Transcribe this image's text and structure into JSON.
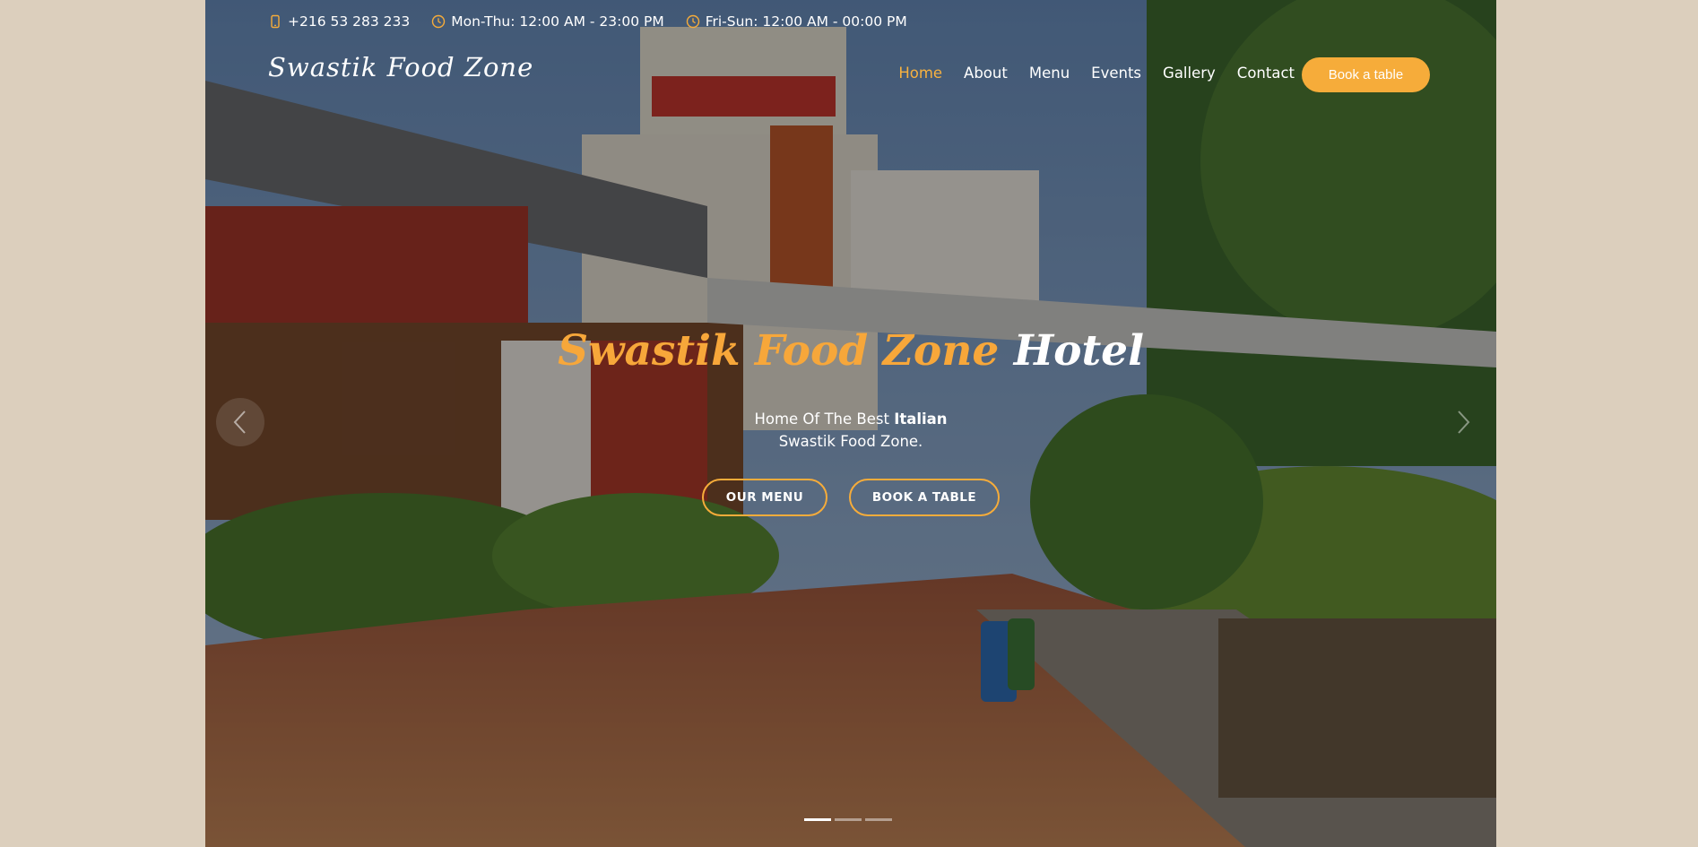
{
  "topbar": {
    "phone": "+216 53 283 233",
    "hours_weekday": "Mon-Thu: 12:00 AM - 23:00 PM",
    "hours_weekend": "Fri-Sun: 12:00 AM - 00:00 PM"
  },
  "brand": {
    "logo": "Swastik Food Zone"
  },
  "nav": {
    "items": [
      "Home",
      "About",
      "Menu",
      "Events",
      "Gallery",
      "Contact"
    ],
    "active": "Home",
    "book_label": "Book a table"
  },
  "hero": {
    "title_accent": "Swastik Food Zone",
    "title_plain": "Hotel",
    "subtitle_prefix": "Home Of The Best",
    "subtitle_bold": "Italian",
    "subtitle_line2": "Swastik Food Zone.",
    "btn_menu": "OUR MENU",
    "btn_table": "BOOK A TABLE",
    "slide_count": 3,
    "active_slide": 1
  },
  "colors": {
    "accent": "#f6ac3a",
    "page_bg": "#dccfbd"
  },
  "icons": [
    "phone-icon",
    "clock-icon",
    "chevron-left-icon",
    "chevron-right-icon"
  ]
}
